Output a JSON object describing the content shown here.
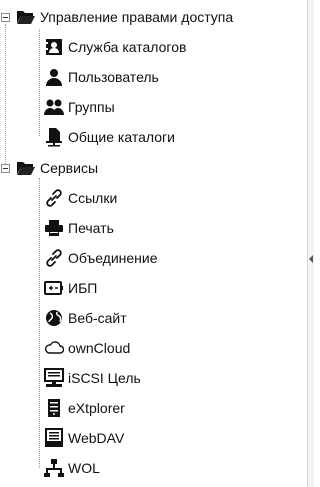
{
  "tree": {
    "groups": [
      {
        "label": "Управление правами доступа",
        "icon": "folder-open-icon",
        "items": [
          {
            "label": "Служба каталогов",
            "icon": "directory-service-icon"
          },
          {
            "label": "Пользователь",
            "icon": "user-icon"
          },
          {
            "label": "Группы",
            "icon": "group-icon"
          },
          {
            "label": "Общие каталоги",
            "icon": "shared-folder-icon"
          }
        ]
      },
      {
        "label": "Сервисы",
        "icon": "folder-open-icon",
        "items": [
          {
            "label": "Ссылки",
            "icon": "link-icon"
          },
          {
            "label": "Печать",
            "icon": "printer-icon"
          },
          {
            "label": "Объединение",
            "icon": "link-icon"
          },
          {
            "label": "ИБП",
            "icon": "battery-icon"
          },
          {
            "label": "Веб-сайт",
            "icon": "globe-icon"
          },
          {
            "label": "ownCloud",
            "icon": "cloud-icon"
          },
          {
            "label": "iSCSI Цель",
            "icon": "server-monitor-icon"
          },
          {
            "label": "eXtplorer",
            "icon": "server-tower-icon"
          },
          {
            "label": "WebDAV",
            "icon": "webdav-icon"
          },
          {
            "label": "WOL",
            "icon": "network-icon"
          }
        ]
      }
    ]
  }
}
